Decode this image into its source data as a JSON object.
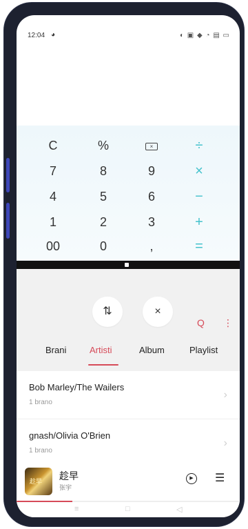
{
  "status_bar": {
    "time": "12:04",
    "left_icon": "notification-icon",
    "right_icons": "◐ ▣ ◆ ◔ ▤ ▭"
  },
  "calculator": {
    "rows": [
      [
        "C",
        "%",
        "⌫",
        "÷"
      ],
      [
        "7",
        "8",
        "9",
        "×"
      ],
      [
        "4",
        "5",
        "6",
        "−"
      ],
      [
        "1",
        "2",
        "3",
        "+"
      ],
      [
        "00",
        "0",
        ",",
        "="
      ]
    ],
    "accent_color": "#44c2cc"
  },
  "music": {
    "sort_icon": "⇅",
    "close_icon": "×",
    "search_icon": "Q",
    "more_icon": "⋮",
    "tabs": [
      "Brani",
      "Artisti",
      "Album",
      "Playlist"
    ],
    "active_tab": "Artisti",
    "artists": [
      {
        "name": "Bob Marley/The Wailers",
        "count": "1 brano"
      },
      {
        "name": "gnash/Olivia O'Brien",
        "count": "1 brano"
      }
    ],
    "now_playing": {
      "title": "趁早",
      "artist": "张宇",
      "cover_text": "趁早"
    },
    "progress": 0.25,
    "accent_color": "#d64a58"
  },
  "navbar": {
    "menu": "≡",
    "home": "□",
    "back": "◁"
  }
}
